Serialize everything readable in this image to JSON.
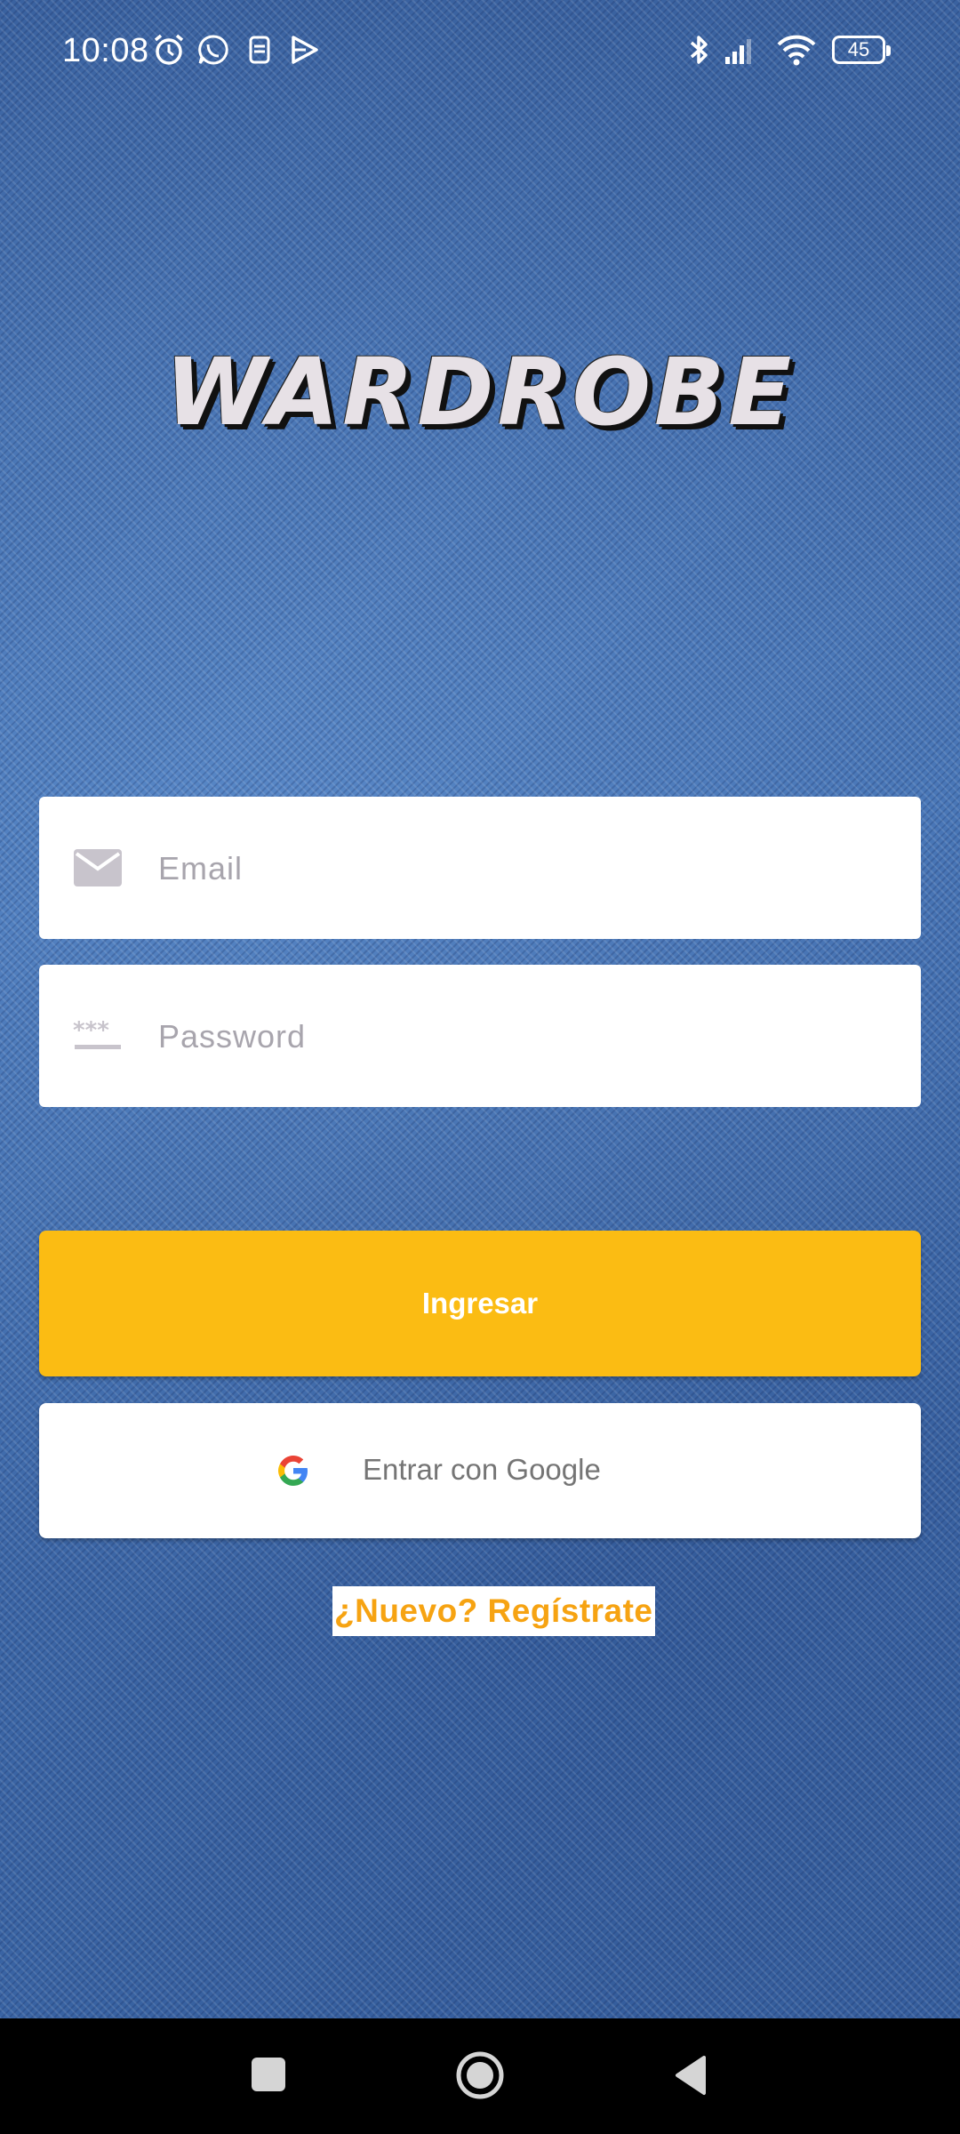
{
  "status_bar": {
    "time": "10:08",
    "battery": "45",
    "icons": [
      "alarm-icon",
      "whatsapp-icon",
      "sim-icon",
      "play-icon",
      "bluetooth-icon",
      "signal-icon",
      "wifi-icon",
      "battery-icon"
    ]
  },
  "app": {
    "title": "WARDROBE"
  },
  "login_form": {
    "email_placeholder": "Email",
    "email_value": "",
    "password_placeholder": "Password",
    "password_value": "",
    "login_label": "Ingresar",
    "google_label": "Entrar con Google",
    "register_label": "¿Nuevo? Regístrate"
  },
  "colors": {
    "primary_button": "#fbbc13",
    "register_text": "#f6a312",
    "denim_background": "#3f6aa8"
  }
}
